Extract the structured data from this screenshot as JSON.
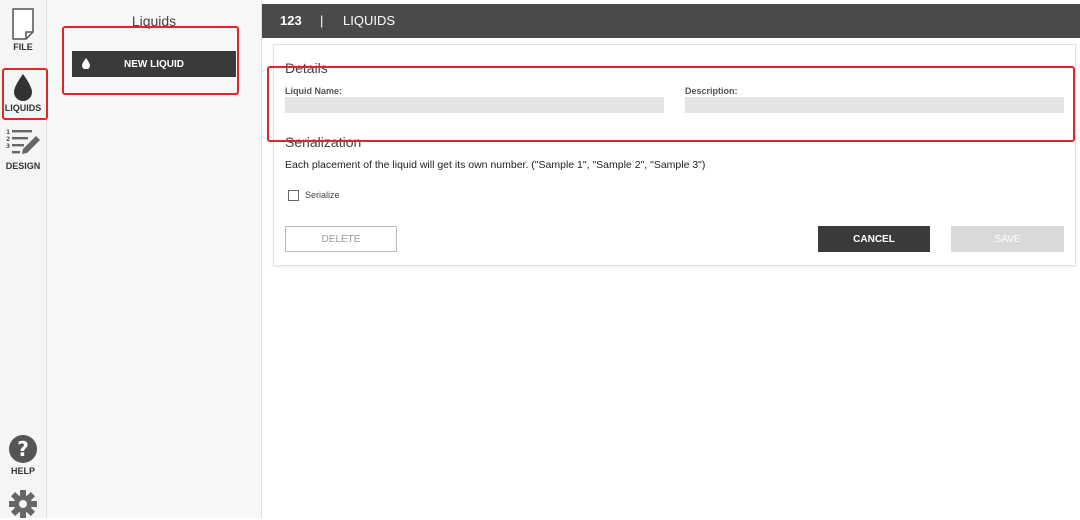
{
  "nav": {
    "file_label": "FILE",
    "liquids_label": "LIQUIDS",
    "design_label": "DESIGN",
    "help_label": "HELP"
  },
  "sidebar": {
    "title": "Liquids",
    "new_liquid_label": "NEW LIQUID"
  },
  "header": {
    "project_number": "123",
    "separator": "|",
    "title": "LIQUIDS"
  },
  "details": {
    "section_title": "Details",
    "liquid_name_label": "Liquid Name:",
    "liquid_name_value": "",
    "description_label": "Description:",
    "description_value": ""
  },
  "serialization": {
    "section_title": "Serialization",
    "description": "Each placement of the liquid will get its own number. (\"Sample 1\", \"Sample 2\", \"Sample 3\")",
    "checkbox_label": "Serialize",
    "checked": false
  },
  "actions": {
    "delete_label": "DELETE",
    "cancel_label": "CANCEL",
    "save_label": "SAVE"
  },
  "colors": {
    "header_bg": "#4a4a4a",
    "dark_button": "#3a3a3a",
    "input_bg": "#e4e4e4",
    "annotation_red": "#e0262a"
  }
}
